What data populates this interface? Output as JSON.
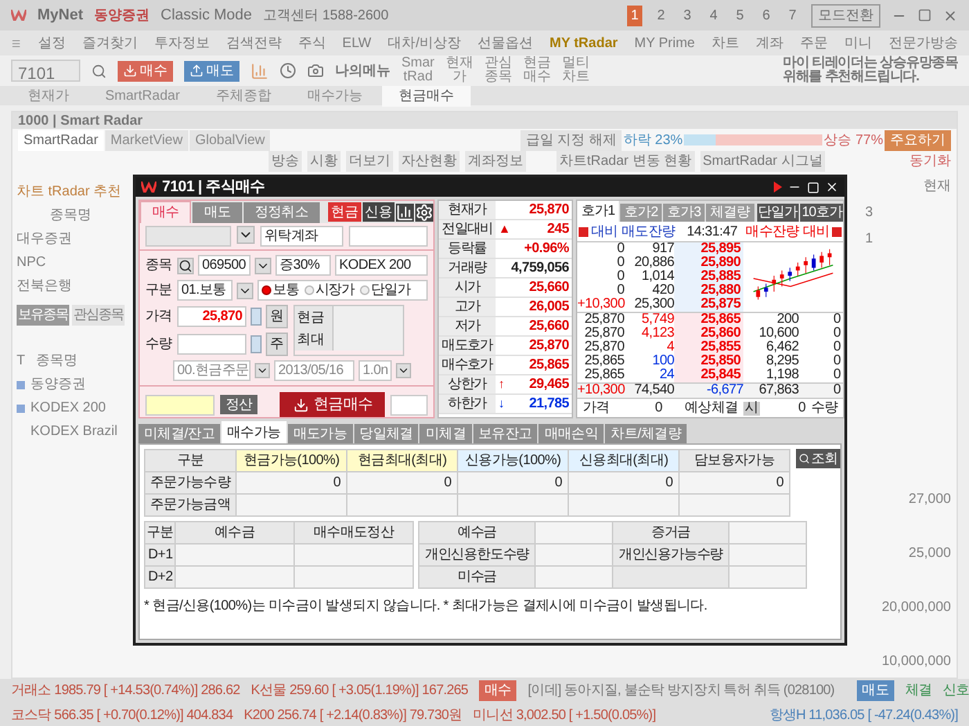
{
  "app_title": {
    "brand": "MyNet",
    "company": "동양증권",
    "mode": "Classic Mode",
    "support": "고객센터 1588-2600",
    "pages": [
      {
        "label": "1",
        "selected": true
      },
      {
        "label": "2",
        "selected": false
      },
      {
        "label": "3",
        "selected": false
      },
      {
        "label": "4",
        "selected": false
      },
      {
        "label": "5",
        "selected": false
      },
      {
        "label": "6",
        "selected": false
      },
      {
        "label": "7",
        "selected": false
      }
    ],
    "mode_switch": "모드전환"
  },
  "menu": [
    {
      "label": "설정",
      "highlighted": false
    },
    {
      "label": "즐겨찾기",
      "highlighted": false
    },
    {
      "label": "투자정보",
      "highlighted": false
    },
    {
      "label": "검색전략",
      "highlighted": false
    },
    {
      "label": "주식",
      "highlighted": false
    },
    {
      "label": "ELW",
      "highlighted": false
    },
    {
      "label": "대차/비상장",
      "highlighted": false
    },
    {
      "label": "선물옵션",
      "highlighted": false
    },
    {
      "label": "MY tRadar",
      "highlighted": true
    },
    {
      "label": "MY Prime",
      "highlighted": false
    },
    {
      "label": "차트",
      "highlighted": false
    },
    {
      "label": "계좌",
      "highlighted": false
    },
    {
      "label": "주문",
      "highlighted": false
    },
    {
      "label": "미니",
      "highlighted": false
    },
    {
      "label": "전문가방송",
      "highlighted": false
    }
  ],
  "toolbar": {
    "screen_no": "7101",
    "buy": "매수",
    "sell": "매도",
    "my_menu": "나의메뉴",
    "shortcuts": [
      [
        "Smar",
        "tRad"
      ],
      [
        "현재",
        "가"
      ],
      [
        "관심",
        "종목"
      ],
      [
        "현금",
        "매수"
      ],
      [
        "멀티",
        "차트"
      ]
    ],
    "promo": [
      "마이 티레이더는 상승유망종목",
      "위해를 추천해드립니다."
    ]
  },
  "screen_tabs": [
    {
      "label": "현재가",
      "selected": false
    },
    {
      "label": "SmartRadar",
      "selected": false
    },
    {
      "label": "주체종합",
      "selected": false
    },
    {
      "label": "매수가능",
      "selected": false
    },
    {
      "label": "현금매수",
      "selected": true
    }
  ],
  "radar_window": {
    "title": "1000 | Smart Radar",
    "tabs": [
      {
        "label": "SmartRadar",
        "selected": true
      },
      {
        "label": "MarketView",
        "selected": false
      },
      {
        "label": "GlobalView",
        "selected": false
      }
    ],
    "sentiment_button": "급일 지정 해제",
    "down": "하락 23%",
    "up": "상승 77%",
    "level": 0.23,
    "action": "주요하기",
    "buttons": [
      "방송",
      "시황",
      "더보기",
      "자산현황",
      "계좌정보"
    ],
    "panel_tabs": [
      "차트tRadar 변동 현황",
      "SmartRadar 시그널"
    ],
    "sync": "동기화",
    "recommend_title": "차트 tRadar 추천",
    "recommend_header": "종목명",
    "recommend_rows": [
      "대우증권",
      "NPC",
      "전북은행"
    ],
    "list_tabs": [
      {
        "label": "보유종목",
        "selected": true
      },
      {
        "label": "관심종목",
        "selected": false
      }
    ],
    "holdings_header": [
      "T",
      "종목명"
    ],
    "holdings": [
      {
        "name": "동양증권",
        "flag": true
      },
      {
        "name": "KODEX 200",
        "flag": true
      },
      {
        "name": "KODEX Brazil",
        "flag": false
      }
    ],
    "side_header": "현재",
    "side_values": [
      "3",
      "1"
    ],
    "axis_labels": [
      "27,000",
      "25,000",
      "20,000,000",
      "10,000,000"
    ]
  },
  "dialog": {
    "title": "7101 | 주식매수",
    "tabs": [
      {
        "label": "매수",
        "selected": true
      },
      {
        "label": "매도",
        "selected": false
      },
      {
        "label": "정정취소",
        "selected": false
      }
    ],
    "modes": [
      {
        "label": "현금",
        "selected": true
      },
      {
        "label": "신용",
        "selected": false
      }
    ],
    "account_type": "위탁계좌",
    "code": "069500",
    "margin": "증30%",
    "stock_name": "KODEX 200",
    "labels": {
      "stock": "종목",
      "type": "구분",
      "price": "가격",
      "qty": "수량",
      "won": "원",
      "unit": "주",
      "cash": "현금",
      "max": "최대"
    },
    "order_type": "01.보통",
    "price_types": [
      {
        "label": "보통",
        "selected": true
      },
      {
        "label": "시장가",
        "selected": false
      },
      {
        "label": "단일가",
        "selected": false
      }
    ],
    "price": "25,870",
    "order_kind": "00.현금주문",
    "date": "2013/05/16",
    "ratio": "1.0n",
    "settle": "정산",
    "submit": "현금매수",
    "quote": [
      {
        "label": "현재가",
        "value": "25,870",
        "color": "#e00000"
      },
      {
        "label": "전일대비",
        "sign": "▲",
        "value": "245",
        "color": "#e00000"
      },
      {
        "label": "등락률",
        "value": "+0.96%",
        "color": "#e00000"
      },
      {
        "label": "거래량",
        "value": "4,759,056",
        "color": "#222222"
      },
      {
        "label": "시가",
        "value": "25,660",
        "color": "#e00000"
      },
      {
        "label": "고가",
        "value": "26,005",
        "color": "#e00000"
      },
      {
        "label": "저가",
        "value": "25,660",
        "color": "#e00000"
      },
      {
        "label": "매도호가",
        "value": "25,870",
        "color": "#e00000"
      },
      {
        "label": "매수호가",
        "value": "25,865",
        "color": "#e00000"
      },
      {
        "label": "상한가",
        "sign": "↑",
        "value": "29,465",
        "color": "#e00000"
      },
      {
        "label": "하한가",
        "sign": "↓",
        "value": "21,785",
        "color": "#0030e0"
      }
    ],
    "book_tabs": [
      {
        "label": "호가1",
        "selected": true
      },
      {
        "label": "호가2",
        "selected": false
      },
      {
        "label": "호가3",
        "selected": false
      },
      {
        "label": "체결량",
        "selected": false
      }
    ],
    "book_buttons": [
      "단일가",
      "10호가"
    ],
    "book_header": {
      "left": "대비 매도잔량",
      "time": "14:31:47",
      "right": "매수잔량 대비"
    },
    "asks": [
      {
        "diff": "0",
        "qty": "917",
        "price": "25,895"
      },
      {
        "diff": "0",
        "qty": "20,886",
        "price": "25,890"
      },
      {
        "diff": "0",
        "qty": "1,014",
        "price": "25,885"
      },
      {
        "diff": "0",
        "qty": "420",
        "price": "25,880"
      },
      {
        "diff": "+10,300",
        "qty": "25,300",
        "price": "25,875"
      }
    ],
    "bids": [
      {
        "diff": "25,870",
        "ask_qty": "5,749",
        "price": "25,865",
        "qty": "200",
        "change": "0"
      },
      {
        "diff": "25,870",
        "ask_qty": "4,123",
        "price": "25,860",
        "qty": "10,600",
        "change": "0"
      },
      {
        "diff": "25,870",
        "ask_qty": "4",
        "price": "25,855",
        "qty": "6,462",
        "change": "0"
      },
      {
        "diff": "25,865",
        "ask_qty": "100",
        "price": "25,850",
        "qty": "8,295",
        "change": "0"
      },
      {
        "diff": "25,865",
        "ask_qty": "24",
        "price": "25,845",
        "qty": "1,198",
        "change": "0"
      }
    ],
    "totals": [
      "+10,300",
      "74,540",
      "-6,677",
      "67,863",
      "0"
    ],
    "expected": {
      "price_label": "가격",
      "price": "0",
      "label": "예상체결",
      "key": "시",
      "qty": "0",
      "qty_label": "수량"
    },
    "bottom_tabs": [
      {
        "label": "미체결/잔고",
        "selected": false
      },
      {
        "label": "매수가능",
        "selected": true
      },
      {
        "label": "매도가능",
        "selected": false
      },
      {
        "label": "당일체결",
        "selected": false
      },
      {
        "label": "미체결",
        "selected": false
      },
      {
        "label": "보유잔고",
        "selected": false
      },
      {
        "label": "매매손익",
        "selected": false
      },
      {
        "label": "차트/체결량",
        "selected": false
      }
    ],
    "avail_columns": [
      {
        "label": "구분",
        "color": "#e8e8e8"
      },
      {
        "label": "현금가능(100%)",
        "color": "#fffbc8"
      },
      {
        "label": "현금최대(최대)",
        "color": "#fffbc8"
      },
      {
        "label": "신용가능(100%)",
        "color": "#e2f2ff"
      },
      {
        "label": "신용최대(최대)",
        "color": "#e2f2ff"
      },
      {
        "label": "담보융자가능",
        "color": "#e8e8e8"
      }
    ],
    "avail_rows": [
      {
        "label": "주문가능수량",
        "values": [
          "0",
          "0",
          "0",
          "0",
          "0"
        ]
      },
      {
        "label": "주문가능금액",
        "values": []
      }
    ],
    "query": "조회",
    "deposit_columns": [
      "구분",
      "예수금",
      "매수매도정산"
    ],
    "deposit_rows": [
      "D+1",
      "D+2"
    ],
    "margin_rows": [
      [
        "예수금",
        "증거금"
      ],
      [
        "개인신용한도수량",
        "개인신용가능수량"
      ],
      [
        "미수금"
      ]
    ],
    "note": "* 현금/신용(100%)는 미수금이 발생되지 않습니다. * 최대가능은 결제시에 미수금이 발생됩니다."
  },
  "status_bar": [
    [
      "거래소 1985.79 [ +14.53(0.74%)] 286.62",
      "K선물 259.60 [ +3.05(1.19%)] 167.265"
    ],
    [
      "코스닥 566.35 [ +0.70(0.12%)] 404.834",
      "K200 256.74 [ +2.14(0.83%)] 79.730원",
      "미니선 3,002.50 [ +1.50(0.05%)]"
    ]
  ],
  "status_buy": "매수",
  "news": "[이데] 동아지질, 불순탁 방지장치 특허 취득 (028100)",
  "status_sell": "매도",
  "status_links": [
    "체결",
    "신호"
  ],
  "overseas": "항생H 11,036.05 [ -47.24(0.43%)]"
}
